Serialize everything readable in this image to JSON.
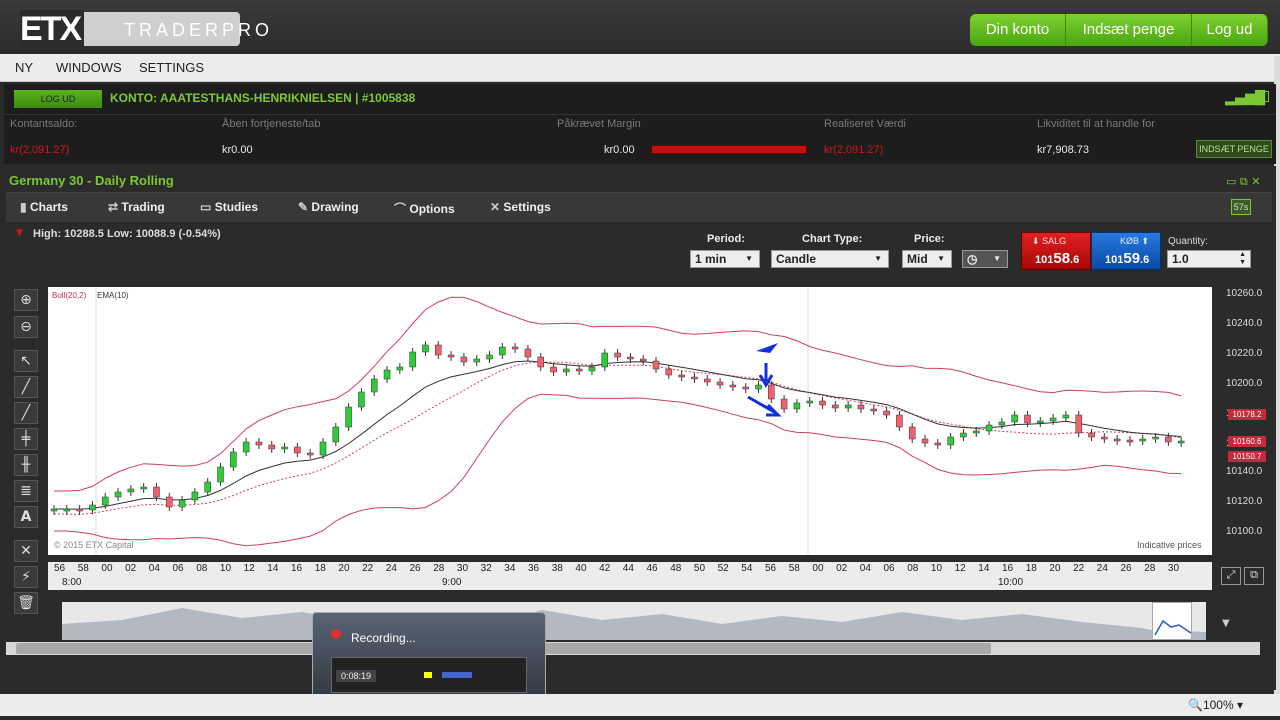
{
  "app": {
    "logo": "ETX",
    "logo_sub": "TRADERPRO"
  },
  "header_buttons": [
    "Din konto",
    "Indsæt penge",
    "Log ud"
  ],
  "menu": [
    "NY",
    "WINDOWS",
    "SETTINGS"
  ],
  "account": {
    "logout": "LOG UD",
    "title": "KONTO: AAATESTHANS-HENRIKNIELSEN | #1005838",
    "labels": [
      "Kontantsaldo:",
      "Åben fortjeneste/tab",
      "Påkrævet Margin",
      "Realiseret Værdi",
      "Likviditet til at handle for"
    ],
    "values": [
      "kr(2,091.27)",
      "kr0.00",
      "kr0.00",
      "kr(2,091.27)",
      "kr7,908.73"
    ],
    "deposit": "INDSÆT PENGE"
  },
  "panel": {
    "title": "Germany 30 - Daily Rolling",
    "badge": "57s",
    "toolbar": [
      "Charts",
      "Trading",
      "Studies",
      "Drawing",
      "Options",
      "Settings"
    ],
    "hilo": "High: 10288.5 Low: 10088.9 (-0.54%)",
    "period_label": "Period:",
    "period": "1 min",
    "type_label": "Chart Type:",
    "type": "Candle",
    "price_label": "Price:",
    "price": "Mid",
    "sell_label": "SALG",
    "sell_pre": "101",
    "sell_big": "58",
    "sell_small": ".6",
    "buy_label": "KØB",
    "buy_pre": "101",
    "buy_big": "59",
    "buy_small": ".6",
    "qty_label": "Quantity:",
    "qty": "1.0"
  },
  "legend": [
    "Boll(20,2)",
    "EMA(10)"
  ],
  "copyright": "© 2015 ETX Capital",
  "indicative": "Indicative prices",
  "y_ticks": [
    "10260.0",
    "10240.0",
    "10220.0",
    "10200.0",
    "10180.0",
    "10160.0",
    "10140.0",
    "10120.0",
    "10100.0"
  ],
  "price_tags": [
    "10178.2",
    "10160.6",
    "10150.7"
  ],
  "x_minutes": [
    "56",
    "58",
    "00",
    "02",
    "04",
    "06",
    "08",
    "10",
    "12",
    "14",
    "16",
    "18",
    "20",
    "22",
    "24",
    "26",
    "28",
    "30",
    "32",
    "34",
    "36",
    "38",
    "40",
    "42",
    "44",
    "46",
    "48",
    "50",
    "52",
    "54",
    "56",
    "58",
    "00",
    "02",
    "04",
    "06",
    "08",
    "10",
    "12",
    "14",
    "16",
    "18",
    "20",
    "22",
    "24",
    "26",
    "28",
    "30"
  ],
  "x_hours": [
    "8:00",
    "9:00",
    "10:00"
  ],
  "recording": {
    "label": "Recording...",
    "time": "0:08:19"
  },
  "zoom": "100%"
}
